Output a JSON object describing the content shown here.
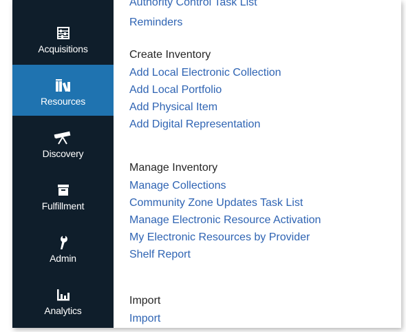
{
  "sidebar": {
    "items": [
      {
        "label": "Acquisitions",
        "icon": "abacus-icon",
        "active": false
      },
      {
        "label": "Resources",
        "icon": "books-icon",
        "active": true
      },
      {
        "label": "Discovery",
        "icon": "telescope-icon",
        "active": false
      },
      {
        "label": "Fulfillment",
        "icon": "archive-box-icon",
        "active": false
      },
      {
        "label": "Admin",
        "icon": "wrench-icon",
        "active": false
      },
      {
        "label": "Analytics",
        "icon": "bar-chart-icon",
        "active": false
      }
    ],
    "background": "#0f1e2b",
    "active_color": "#1f73b0"
  },
  "content": {
    "top_cut_link": "Authority Control Task List",
    "top_link": "Reminders",
    "sections": [
      {
        "title": "Create Inventory",
        "links": [
          "Add Local Electronic Collection",
          "Add Local Portfolio",
          "Add Physical Item",
          "Add Digital Representation"
        ]
      },
      {
        "title": "Manage Inventory",
        "links": [
          "Manage Collections",
          "Community Zone Updates Task List",
          "Manage Electronic Resource Activation",
          "My Electronic Resources by Provider",
          "Shelf Report"
        ]
      },
      {
        "title": "Import",
        "links": [
          "Import"
        ]
      }
    ],
    "link_color": "#2f64b3"
  }
}
